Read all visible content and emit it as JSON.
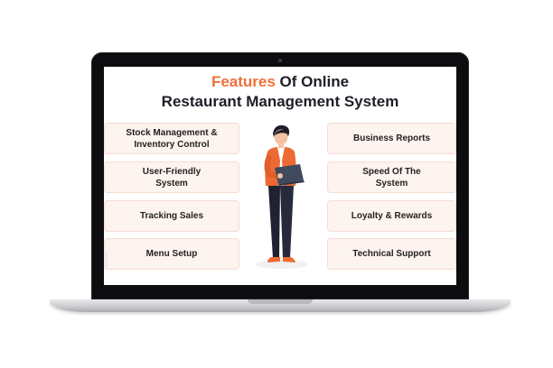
{
  "title": {
    "line1_accent": "Features",
    "line1_rest": " Of Online",
    "line2": "Restaurant Management System"
  },
  "features_left": [
    "Stock Management & Inventory Control",
    "User-Friendly System",
    "Tracking Sales",
    "Menu Setup"
  ],
  "features_right": [
    "Business Reports",
    "Speed Of The System",
    "Loyalty & Rewards",
    "Technical Support"
  ],
  "colors": {
    "accent": "#ef6f3c",
    "card_bg": "#fdf3ef",
    "text": "#1e1e28"
  },
  "icons": [
    "person-with-laptop-illustration",
    "laptop-frame"
  ]
}
